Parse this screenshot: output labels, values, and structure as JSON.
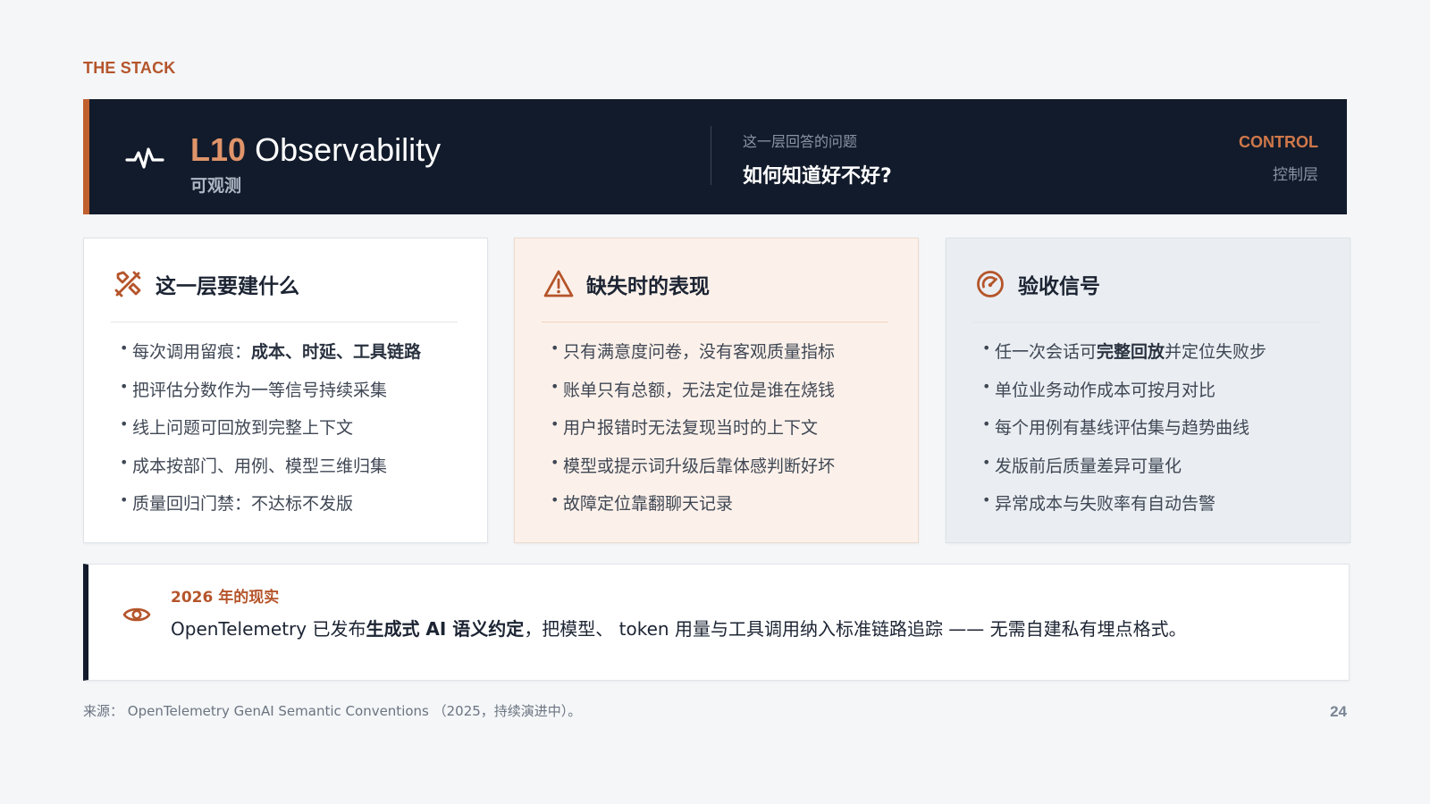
{
  "kicker": "THE STACK",
  "header": {
    "code": "L10",
    "name": "Observability",
    "subtitle": "可观测",
    "question_label": "这一层回答的问题",
    "question": "如何知道好不好?",
    "tier": "CONTROL",
    "tier_sub": "控制层",
    "accent": "#c0602f",
    "background": "#121b2b"
  },
  "cards": [
    {
      "icon": "tools-icon",
      "title": "这一层要建什么",
      "items": [
        {
          "pre": "每次调用留痕：",
          "bold": "成本、时延、工具链路",
          "post": ""
        },
        {
          "pre": "把评估分数作为一等信号持续采集",
          "bold": "",
          "post": ""
        },
        {
          "pre": "线上问题可回放到完整上下文",
          "bold": "",
          "post": ""
        },
        {
          "pre": "成本按部门、用例、模型三维归集",
          "bold": "",
          "post": ""
        },
        {
          "pre": "质量回归门禁：不达标不发版",
          "bold": "",
          "post": ""
        }
      ]
    },
    {
      "icon": "warning-icon",
      "title": "缺失时的表现",
      "items": [
        {
          "pre": "只有满意度问卷，没有客观质量指标",
          "bold": "",
          "post": ""
        },
        {
          "pre": "账单只有总额，无法定位是谁在烧钱",
          "bold": "",
          "post": ""
        },
        {
          "pre": "用户报错时无法复现当时的上下文",
          "bold": "",
          "post": ""
        },
        {
          "pre": "模型或提示词升级后靠体感判断好坏",
          "bold": "",
          "post": ""
        },
        {
          "pre": "故障定位靠翻聊天记录",
          "bold": "",
          "post": ""
        }
      ]
    },
    {
      "icon": "gauge-icon",
      "title": "验收信号",
      "items": [
        {
          "pre": "任一次会话可",
          "bold": "完整回放",
          "post": "并定位失败步"
        },
        {
          "pre": "单位业务动作成本可按月对比",
          "bold": "",
          "post": ""
        },
        {
          "pre": "每个用例有基线评估集与趋势曲线",
          "bold": "",
          "post": ""
        },
        {
          "pre": "发版前后质量差异可量化",
          "bold": "",
          "post": ""
        },
        {
          "pre": "异常成本与失败率有自动告警",
          "bold": "",
          "post": ""
        }
      ]
    }
  ],
  "callout": {
    "icon": "eye-icon",
    "year": "2026 年的现实",
    "pre": "OpenTelemetry 已发布",
    "bold": "生成式 AI 语义约定",
    "post": "，把模型、 token 用量与工具调用纳入标准链路追踪 —— 无需自建私有埋点格式。"
  },
  "source": "来源： OpenTelemetry GenAI Semantic Conventions （2025，持续演进中）。",
  "page_number": "24"
}
